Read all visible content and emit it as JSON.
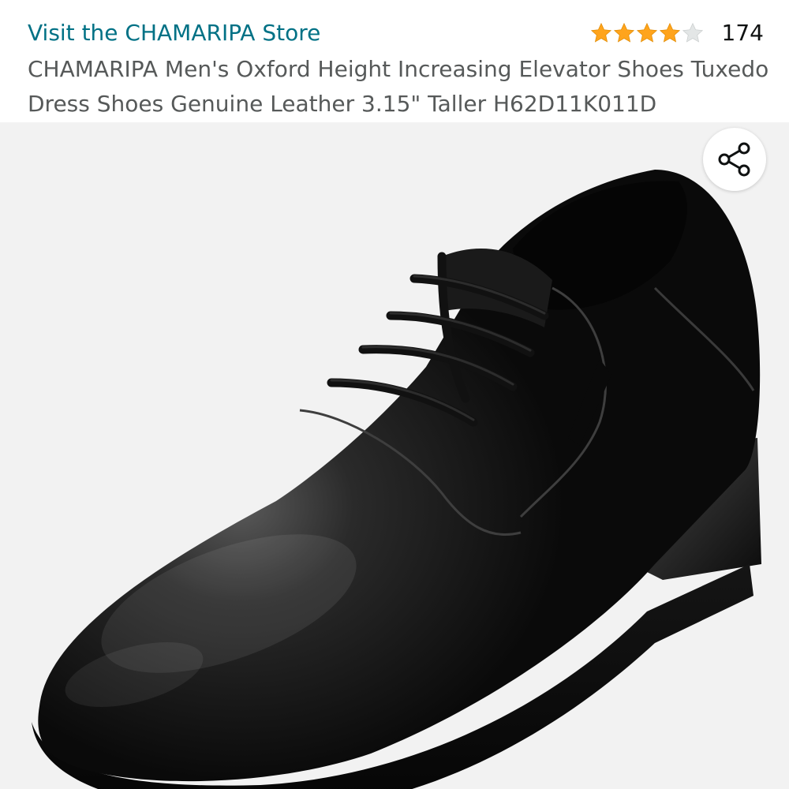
{
  "store": {
    "link_text": "Visit the CHAMARIPA Store",
    "color": "#007185"
  },
  "rating": {
    "stars": 4,
    "max_stars": 5,
    "count": "174",
    "star_color": "#FFA41C",
    "empty_star_color": "#D5D9D9"
  },
  "product": {
    "title": "CHAMARIPA Men's Oxford Height Increasing Elevator Shoes Tuxedo Dress Shoes Genuine Leather 3.15\" Taller H62D11K011D"
  },
  "image": {
    "subject": "black-leather-oxford-shoe-icon",
    "background": "#F2F2F2"
  },
  "share": {
    "icon": "share-icon"
  }
}
